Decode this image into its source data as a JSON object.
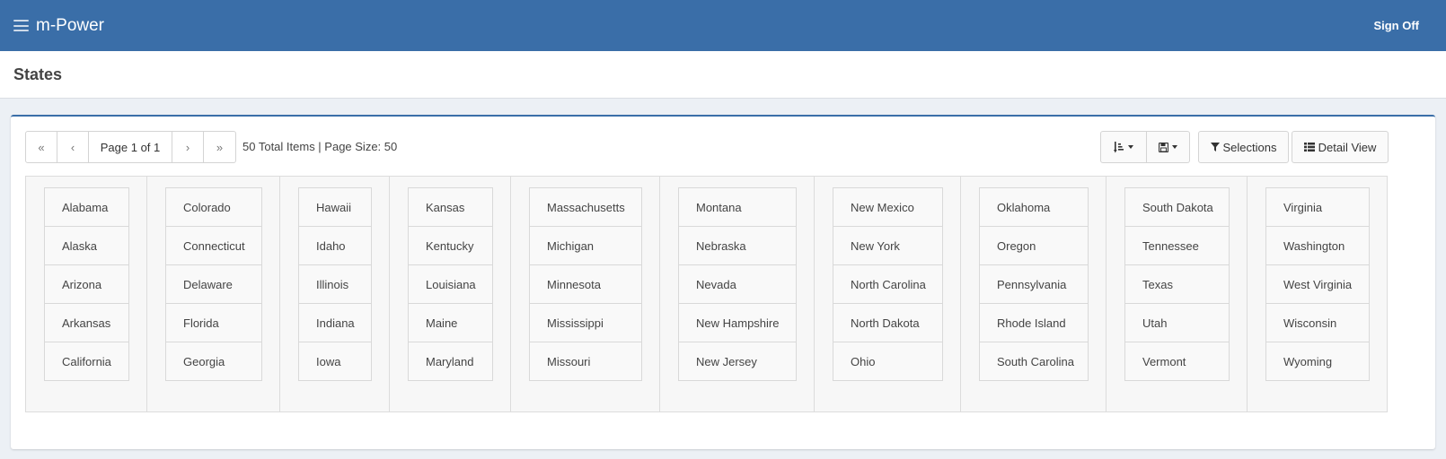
{
  "header": {
    "brand": "m-Power",
    "sign_off": "Sign Off"
  },
  "page": {
    "title": "States"
  },
  "pager": {
    "first": "«",
    "prev": "‹",
    "page_label": "Page 1 of 1",
    "next": "›",
    "last": "»",
    "total_info": "50 Total Items | Page Size: 50"
  },
  "toolbar": {
    "selections": "Selections",
    "detail_view": "Detail View"
  },
  "columns": [
    [
      "Alabama",
      "Alaska",
      "Arizona",
      "Arkansas",
      "California"
    ],
    [
      "Colorado",
      "Connecticut",
      "Delaware",
      "Florida",
      "Georgia"
    ],
    [
      "Hawaii",
      "Idaho",
      "Illinois",
      "Indiana",
      "Iowa"
    ],
    [
      "Kansas",
      "Kentucky",
      "Louisiana",
      "Maine",
      "Maryland"
    ],
    [
      "Massachusetts",
      "Michigan",
      "Minnesota",
      "Mississippi",
      "Missouri"
    ],
    [
      "Montana",
      "Nebraska",
      "Nevada",
      "New Hampshire",
      "New Jersey"
    ],
    [
      "New Mexico",
      "New York",
      "North Carolina",
      "North Dakota",
      "Ohio"
    ],
    [
      "Oklahoma",
      "Oregon",
      "Pennsylvania",
      "Rhode Island",
      "South Carolina"
    ],
    [
      "South Dakota",
      "Tennessee",
      "Texas",
      "Utah",
      "Vermont"
    ],
    [
      "Virginia",
      "Washington",
      "West Virginia",
      "Wisconsin",
      "Wyoming"
    ]
  ],
  "colors": {
    "header_bg": "#3a6ea8",
    "page_bg": "#ecf0f5"
  }
}
